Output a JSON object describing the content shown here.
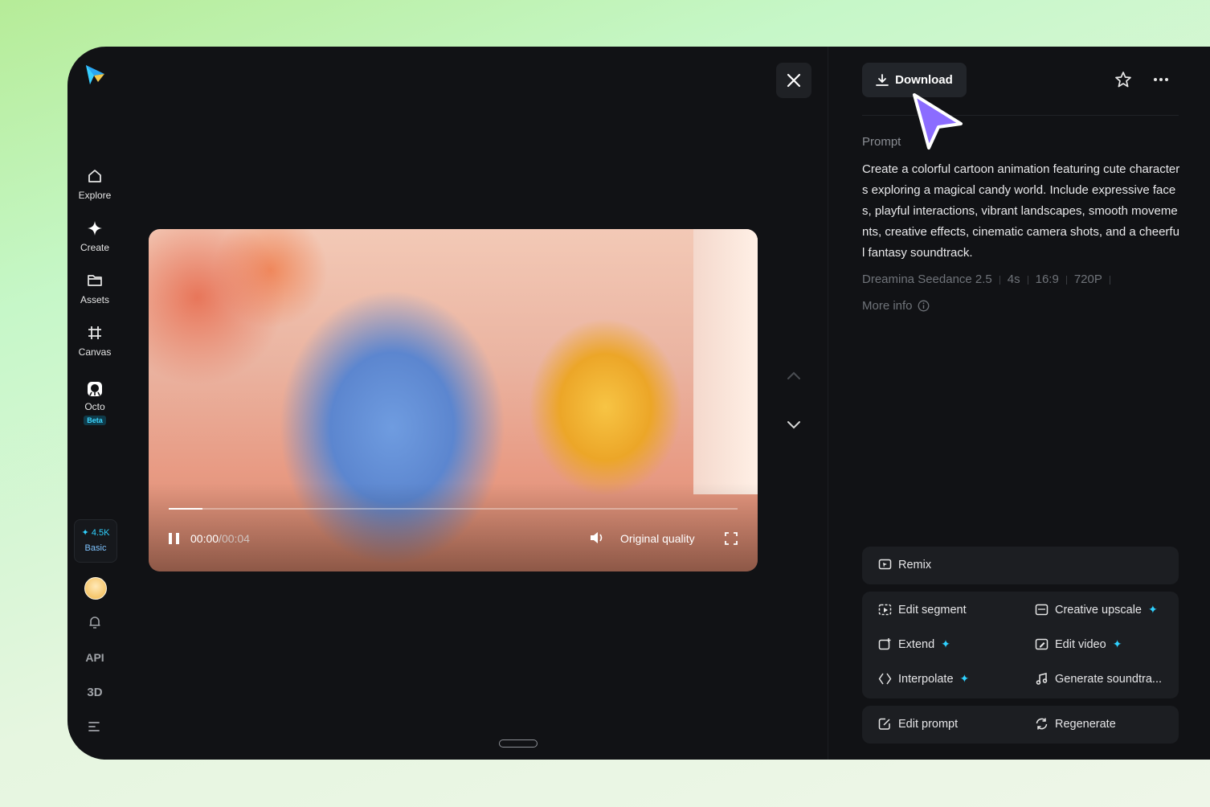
{
  "sidebar": {
    "items": [
      {
        "label": "Explore",
        "icon": "home-icon"
      },
      {
        "label": "Create",
        "icon": "sparkle-icon"
      },
      {
        "label": "Assets",
        "icon": "folder-icon"
      },
      {
        "label": "Canvas",
        "icon": "canvas-icon"
      },
      {
        "label": "Octo",
        "icon": "octo-icon",
        "badge": "Beta"
      }
    ],
    "credits": {
      "amount": "4.5K",
      "plan": "Basic"
    },
    "api_label": "API",
    "three_d_label": "3D"
  },
  "player": {
    "current_time": "00:00",
    "separator": "/",
    "duration": "00:04",
    "quality_label": "Original quality",
    "progress_fraction": 0.06
  },
  "panel": {
    "download_label": "Download",
    "prompt_label": "Prompt",
    "prompt_text": "Create a colorful cartoon animation featuring cute characters exploring a magical candy world. Include expressive faces, playful interactions, vibrant landscapes, smooth movements, creative effects, cinematic camera shots, and a cheerful fantasy soundtrack.",
    "meta": [
      "Dreamina Seedance 2.5",
      "4s",
      "16:9",
      "720P"
    ],
    "more_info": "More info",
    "actions": {
      "remix": "Remix",
      "edit_segment": "Edit segment",
      "creative_upscale": "Creative upscale",
      "extend": "Extend",
      "edit_video": "Edit video",
      "interpolate": "Interpolate",
      "generate_soundtrack": "Generate soundtra...",
      "edit_prompt": "Edit prompt",
      "regenerate": "Regenerate"
    }
  },
  "colors": {
    "accent": "#2fd1ff",
    "cursor": "#8b6cff",
    "panel_bg": "#111215"
  }
}
